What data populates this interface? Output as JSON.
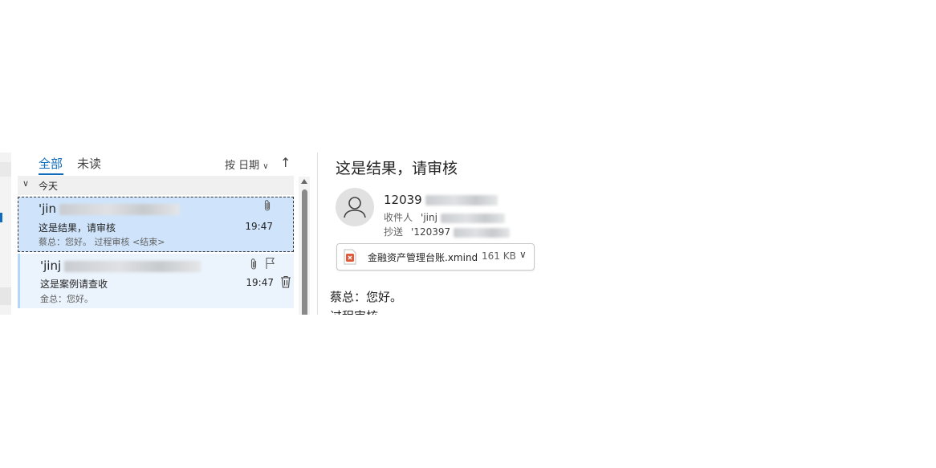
{
  "folder_pane": {},
  "message_list": {
    "tabs": {
      "all": "全部",
      "unread": "未读"
    },
    "sort": {
      "label": "按 日期",
      "direction_icon": "arrow-up-icon"
    },
    "group": {
      "label": "今天"
    },
    "items": [
      {
        "sender": "'jin",
        "subject": "这是结果，请审核",
        "preview": "蔡总：您好。   过程审核 <结束>",
        "time": "19:47",
        "has_attachment": true,
        "selected": true
      },
      {
        "sender": "'jinj",
        "subject": "这是案例请查收",
        "preview": "金总：您好。",
        "time": "19:47",
        "has_attachment": true,
        "flagged": false
      }
    ]
  },
  "reading_pane": {
    "subject": "这是结果，请审核",
    "from": "12039",
    "to": {
      "label": "收件人",
      "value": "'jinj"
    },
    "cc": {
      "label": "抄送",
      "value": "'120397"
    },
    "attachment": {
      "name": "金融资产管理台账.xmind",
      "size": "161 KB"
    },
    "body": [
      "蔡总：您好。",
      "过程审核"
    ]
  },
  "colors": {
    "accent": "#0f6cbd",
    "selected_item": "#cfe4fa",
    "unread_item": "#ebf3fc",
    "file_icon": "#e05a3a"
  }
}
